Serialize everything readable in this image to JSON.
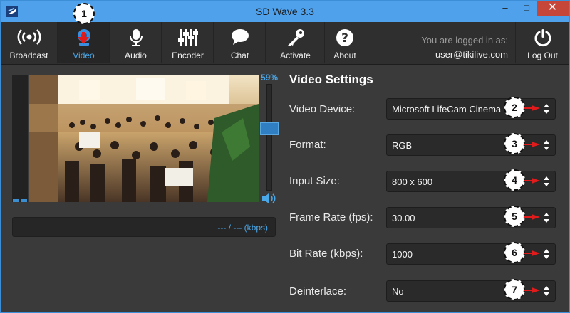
{
  "window": {
    "title": "SD Wave 3.3",
    "minimize_glyph": "–",
    "maximize_glyph": "□",
    "close_glyph": "✕"
  },
  "toolbar": {
    "items": [
      {
        "label": "Broadcast",
        "icon": "broadcast-icon"
      },
      {
        "label": "Video",
        "icon": "webcam-icon",
        "active": true
      },
      {
        "label": "Audio",
        "icon": "microphone-icon"
      },
      {
        "label": "Encoder",
        "icon": "sliders-icon"
      },
      {
        "label": "Chat",
        "icon": "chat-bubble-icon"
      },
      {
        "label": "Activate",
        "icon": "key-icon"
      },
      {
        "label": "About",
        "icon": "question-icon"
      }
    ],
    "login_prefix": "You are logged in as:",
    "login_user": "user@tikilive.com",
    "logout": {
      "label": "Log Out",
      "icon": "power-icon"
    }
  },
  "preview": {
    "volume_percent": "59%",
    "volume_level": 0.59,
    "bitrate_text": "--- / --- (kbps)"
  },
  "settings": {
    "title": "Video Settings",
    "fields": [
      {
        "label": "Video Device:",
        "value": "Microsoft LifeCam Cinema"
      },
      {
        "label": "Format:",
        "value": "RGB"
      },
      {
        "label": "Input Size:",
        "value": "800 x 600"
      },
      {
        "label": "Frame Rate (fps):",
        "value": "30.00"
      },
      {
        "label": "Bit Rate (kbps):",
        "value": "1000"
      },
      {
        "label": "Deinterlace:",
        "value": "No"
      }
    ]
  },
  "callouts": [
    "1",
    "2",
    "3",
    "4",
    "5",
    "6",
    "7"
  ],
  "colors": {
    "accent": "#4aa7e8",
    "titlebar": "#4fa1ec",
    "close": "#c7463a",
    "annotation_red": "#e11b1b"
  }
}
